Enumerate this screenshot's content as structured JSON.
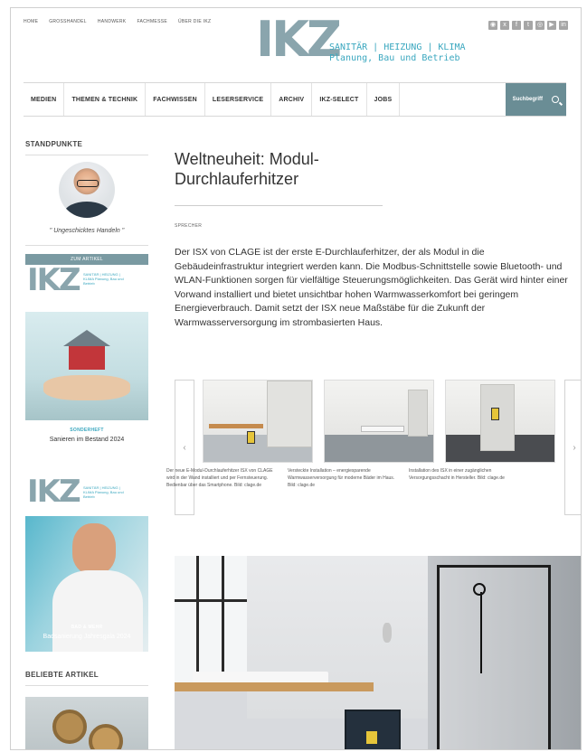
{
  "header": {
    "top_links": [
      "HOME",
      "GROSSHANDEL",
      "HANDWERK",
      "FACHMESSE",
      "ÜBER DIE IKZ"
    ],
    "logo": "IKZ",
    "tagline_line1": "SANITÄR | HEIZUNG | KLIMA",
    "tagline_line2": "Planung, Bau und Betrieb",
    "social_icons": [
      "rss-icon",
      "xing-icon",
      "facebook-icon",
      "twitter-icon",
      "instagram-icon",
      "youtube-icon",
      "linkedin-icon"
    ]
  },
  "nav": {
    "items": [
      "MEDIEN",
      "THEMEN & TECHNIK",
      "FACHWISSEN",
      "LESERSERVICE",
      "ARCHIV",
      "IKZ-SELECT",
      "JOBS"
    ],
    "search_label": "Suchbegriff"
  },
  "sidebar": {
    "standpunkte_heading": "STANDPUNKTE",
    "quote": "\" Ungeschicktes Handeln \"",
    "mag1": {
      "band": "ZUM ARTIKEL",
      "logo": "IKZ",
      "tag": "SANITÄR | HEIZUNG | KLIMA Planung, Bau und Betrieb",
      "kicker": "SONDERHEFT",
      "title": "Sanieren im Bestand 2024"
    },
    "mag2": {
      "logo": "IKZ",
      "tag": "SANITÄR | HEIZUNG | KLIMA Planung, Bau und Betrieb",
      "kicker": "BAD & MEHR",
      "title": "Badsanierung Jahresgala 2024"
    },
    "popular_heading": "BELIEBTE ARTIKEL"
  },
  "article": {
    "title": "Weltneuheit: Modul-Durchlauferhitzer",
    "byline": "SPRECHER",
    "body": "Der ISX von CLAGE ist der erste E-Durchlauferhitzer, der als Modul in die Gebäudeinfrastruktur integriert werden kann. Die Modbus-Schnittstelle sowie Bluetooth- und WLAN-Funktionen sorgen für vielfältige Steuerungsmöglichkeiten. Das Gerät wird hinter einer Vorwand installiert und bietet unsichtbar hohen Warmwasserkomfort bei geringem Energieverbrauch. Damit setzt der ISX neue Maßstäbe für die Zukunft der Warmwasserversorgung im strombasierten Haus.",
    "carousel": {
      "prev": "‹",
      "next": "›",
      "captions": [
        "Der neue E-Modul-Durchlauferhitzer ISX von CLAGE wird in der Wand installiert und per Fernsteuerung. Bedienbar über das Smartphone. Bild: clage.de",
        "Versteckte Installation – energiesparende Warmwasserversorgung für moderne Bäder im Haus. Bild: clage.de",
        "Installation des ISX in einer zugänglichen Versorgungsschacht in Hersteller. Bild: clage.de"
      ]
    }
  }
}
